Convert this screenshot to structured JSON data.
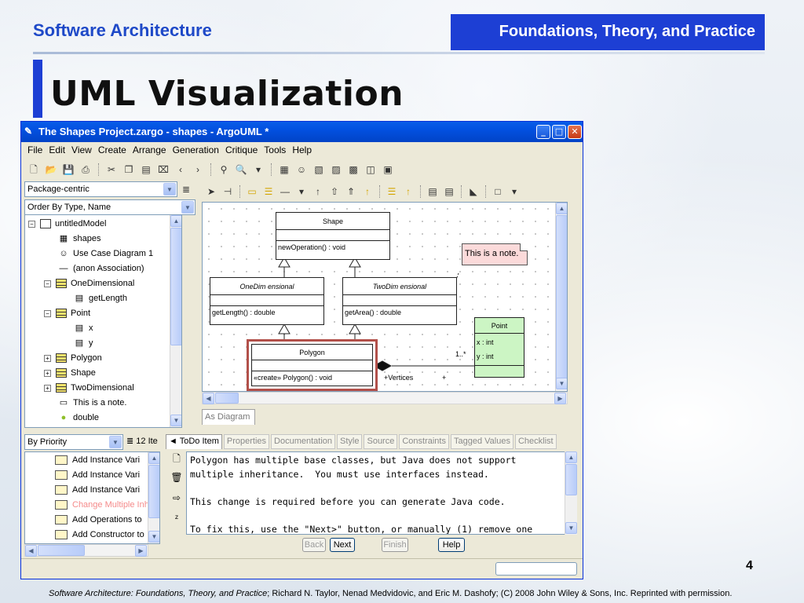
{
  "slide": {
    "header_left": "Software Architecture",
    "header_right": "Foundations, Theory, and Practice",
    "title": "UML Visualization",
    "page_number": "4",
    "footer_italic": "Software Architecture: Foundations, Theory, and Practice",
    "footer_rest": "; Richard N. Taylor, Nenad Medvidovic, and Eric M. Dashofy; (C) 2008 John Wiley & Sons, Inc. Reprinted with permission."
  },
  "window": {
    "title": "The Shapes Project.zargo - shapes - ArgoUML *",
    "menu": [
      "File",
      "Edit",
      "View",
      "Create",
      "Arrange",
      "Generation",
      "Critique",
      "Tools",
      "Help"
    ]
  },
  "explorer": {
    "perspective": "Package-centric",
    "order": "Order By Type, Name",
    "tree": [
      {
        "label": "untitledModel"
      },
      {
        "label": "shapes"
      },
      {
        "label": "Use Case Diagram 1"
      },
      {
        "label": "(anon Association)"
      },
      {
        "label": "OneDimensional"
      },
      {
        "label": "getLength"
      },
      {
        "label": "Point"
      },
      {
        "label": "x"
      },
      {
        "label": "y"
      },
      {
        "label": "Polygon"
      },
      {
        "label": "Shape"
      },
      {
        "label": "TwoDimensional"
      },
      {
        "label": "This is a note."
      },
      {
        "label": "double"
      }
    ]
  },
  "diagram": {
    "tab": "As Diagram",
    "shape": {
      "name": "Shape",
      "op": "newOperation() : void"
    },
    "one_dim": {
      "name": "OneDim ensional",
      "op": "getLength() : double"
    },
    "two_dim": {
      "name": "TwoDim ensional",
      "op": "getArea() : double"
    },
    "polygon": {
      "name": "Polygon",
      "op": "«create» Polygon() : void"
    },
    "point": {
      "name": "Point",
      "attr1": "x : int",
      "attr2": "y : int"
    },
    "note": "This is a note.",
    "multiplicity": "1..*",
    "role": "+Vertices",
    "plus": "+"
  },
  "todo": {
    "sort": "By Priority",
    "count": "12 Ite",
    "items": [
      "Add Instance Vari",
      "Add Instance Vari",
      "Add Instance Vari",
      "Change Multiple Inh",
      "Add Operations to",
      "Add Constructor to"
    ],
    "highlight_color": "#f58a8a"
  },
  "details": {
    "tabs": [
      "◄ ToDo Item",
      "Properties",
      "Documentation",
      "Style",
      "Source",
      "Constraints",
      "Tagged Values",
      "Checklist"
    ],
    "text": "Polygon has multiple base classes, but Java does not support\nmultiple inheritance.  You must use interfaces instead.\n\nThis change is required before you can generate Java code.\n\nTo fix this, use the \"Next>\" button, or manually (1) remove one",
    "buttons": {
      "back": "Back",
      "next": "Next",
      "finish": "Finish",
      "help": "Help"
    }
  }
}
